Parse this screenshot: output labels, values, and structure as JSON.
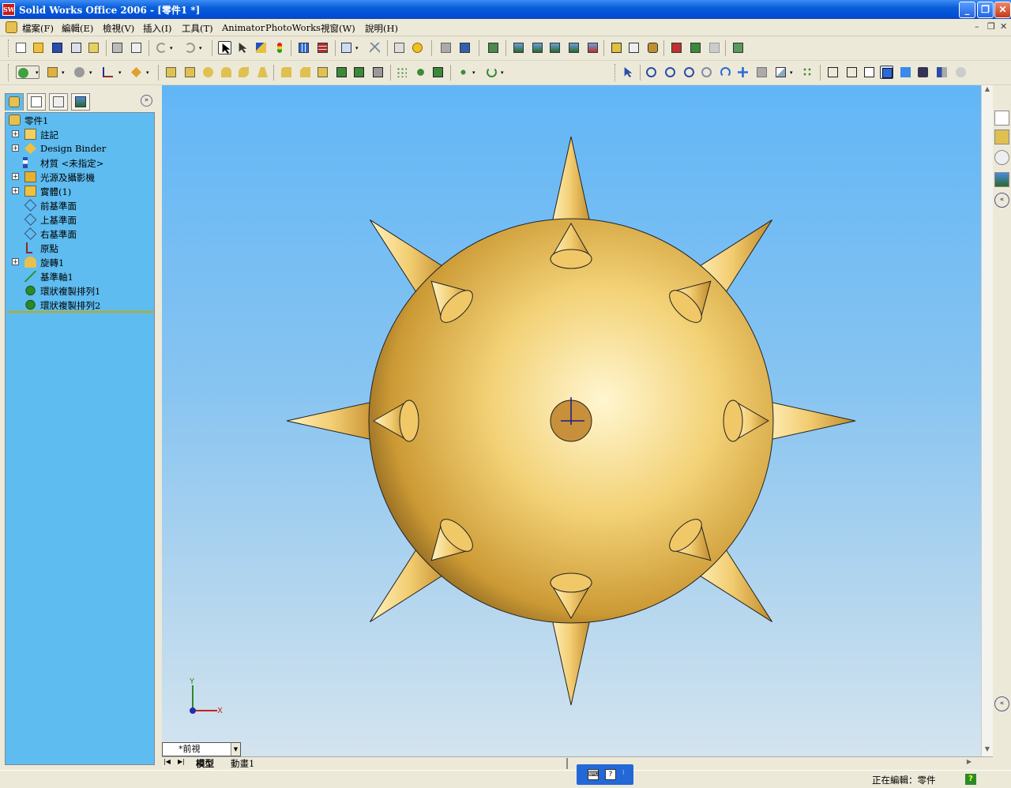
{
  "window": {
    "title": "Solid Works Office 2006 - [零件1 *]"
  },
  "menu": [
    "檔案(F)",
    "編輯(E)",
    "檢視(V)",
    "插入(I)",
    "工具(T)",
    "Animator",
    "PhotoWorks",
    "視窗(W)",
    "說明(H)"
  ],
  "tree": {
    "root": "零件1",
    "items": [
      {
        "label": "註記",
        "expand": true,
        "icon": "annotation-icon"
      },
      {
        "label": "Design Binder",
        "expand": true,
        "icon": "design-binder-icon"
      },
      {
        "label": "材質 <未指定>",
        "expand": false,
        "icon": "material-icon"
      },
      {
        "label": "光源及攝影機",
        "expand": true,
        "icon": "lights-camera-icon"
      },
      {
        "label": "實體(1)",
        "expand": true,
        "icon": "solid-bodies-icon"
      },
      {
        "label": "前基準面",
        "expand": false,
        "icon": "plane-icon"
      },
      {
        "label": "上基準面",
        "expand": false,
        "icon": "plane-icon"
      },
      {
        "label": "右基準面",
        "expand": false,
        "icon": "plane-icon"
      },
      {
        "label": "原點",
        "expand": false,
        "icon": "origin-icon"
      },
      {
        "label": "旋轉1",
        "expand": true,
        "icon": "revolve-feature-icon"
      },
      {
        "label": "基準軸1",
        "expand": false,
        "icon": "axis-icon"
      },
      {
        "label": "環狀複製排列1",
        "expand": false,
        "icon": "circular-pattern-icon"
      },
      {
        "label": "環狀複製排列2",
        "expand": false,
        "icon": "circular-pattern-icon"
      }
    ]
  },
  "view": {
    "current": "*前視",
    "tabs": [
      "模型",
      "動畫1"
    ],
    "triad_x": "X",
    "triad_y": "Y"
  },
  "status": {
    "text": "正在編輯：零件",
    "help": "?"
  },
  "colors": {
    "model": "#f0c868",
    "tree_bg": "#5ebcf0",
    "accent": "#0a5fd8"
  }
}
